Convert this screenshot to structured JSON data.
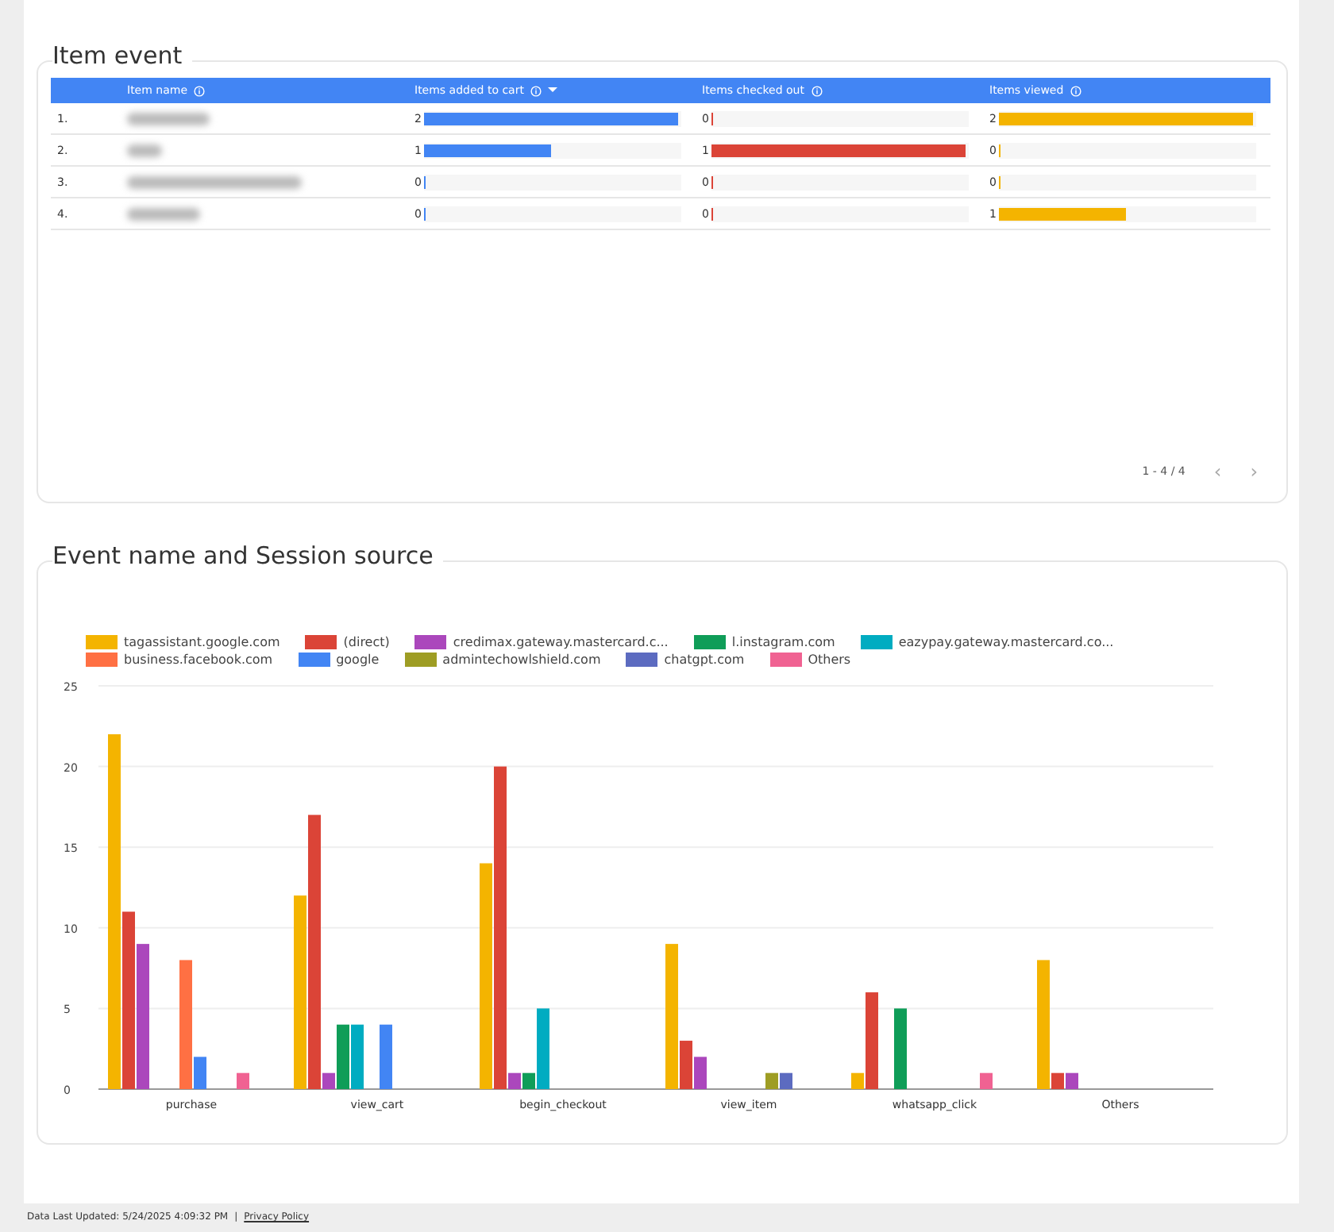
{
  "item_event": {
    "title": "Item event",
    "columns": [
      {
        "label": "Item name",
        "sorted": false
      },
      {
        "label": "Items added to cart",
        "sorted": true
      },
      {
        "label": "Items checked out",
        "sorted": false
      },
      {
        "label": "Items viewed",
        "sorted": false
      }
    ],
    "rows": [
      {
        "index": "1.",
        "cart": {
          "value": "2",
          "level": 1
        },
        "checkout": {
          "value": "0",
          "level": 0
        },
        "viewed": {
          "value": "2",
          "level": 1
        }
      },
      {
        "index": "2.",
        "cart": {
          "value": "1",
          "level": 0.5
        },
        "checkout": {
          "value": "1",
          "level": 1
        },
        "viewed": {
          "value": "0",
          "level": 0
        }
      },
      {
        "index": "3.",
        "cart": {
          "value": "0",
          "level": 0
        },
        "checkout": {
          "value": "0",
          "level": 0
        },
        "viewed": {
          "value": "0",
          "level": 0
        }
      },
      {
        "index": "4.",
        "cart": {
          "value": "0",
          "level": 0
        },
        "checkout": {
          "value": "0",
          "level": 0
        },
        "viewed": {
          "value": "1",
          "level": 0.5
        }
      }
    ],
    "pagination": {
      "range": "1 - 4 / 4",
      "prev": "‹",
      "next": "›"
    }
  },
  "event_chart": {
    "title": "Event name and Session source",
    "chart_data": {
      "type": "bar",
      "grid": true,
      "categories": [
        "purchase",
        "view_cart",
        "begin_checkout",
        "view_item",
        "whatsapp_click",
        "Others"
      ],
      "ylim": [
        0,
        25
      ],
      "yticks": [
        0,
        5,
        10,
        15,
        20,
        25
      ],
      "series": [
        {
          "name": "tagassistant.google.com",
          "color": "#f4b400",
          "values": [
            22,
            12,
            14,
            9,
            1,
            8
          ]
        },
        {
          "name": "(direct)",
          "color": "#db4437",
          "values": [
            11,
            17,
            20,
            3,
            6,
            1
          ]
        },
        {
          "name": "credimax.gateway.mastercard.c...",
          "color": "#ab47bc",
          "values": [
            9,
            1,
            1,
            2,
            0,
            1
          ]
        },
        {
          "name": "l.instagram.com",
          "color": "#0f9d58",
          "values": [
            0,
            4,
            1,
            0,
            5,
            0
          ]
        },
        {
          "name": "eazypay.gateway.mastercard.co...",
          "color": "#00acc1",
          "values": [
            0,
            4,
            5,
            0,
            0,
            0
          ]
        },
        {
          "name": "business.facebook.com",
          "color": "#ff7043",
          "values": [
            8,
            0,
            0,
            0,
            0,
            0
          ]
        },
        {
          "name": "google",
          "color": "#4285f4",
          "values": [
            2,
            4,
            0,
            0,
            0,
            0
          ]
        },
        {
          "name": "admintechowlshield.com",
          "color": "#9e9d24",
          "values": [
            0,
            0,
            0,
            1,
            0,
            0
          ]
        },
        {
          "name": "chatgpt.com",
          "color": "#5c6bc0",
          "values": [
            0,
            0,
            0,
            1,
            0,
            0
          ]
        },
        {
          "name": "Others",
          "color": "#f06292",
          "values": [
            1,
            0,
            0,
            0,
            1,
            0
          ]
        }
      ]
    }
  },
  "footer": {
    "updated": "Data Last Updated: 5/24/2025 4:09:32 PM",
    "separator": "|",
    "link": "Privacy Policy"
  }
}
